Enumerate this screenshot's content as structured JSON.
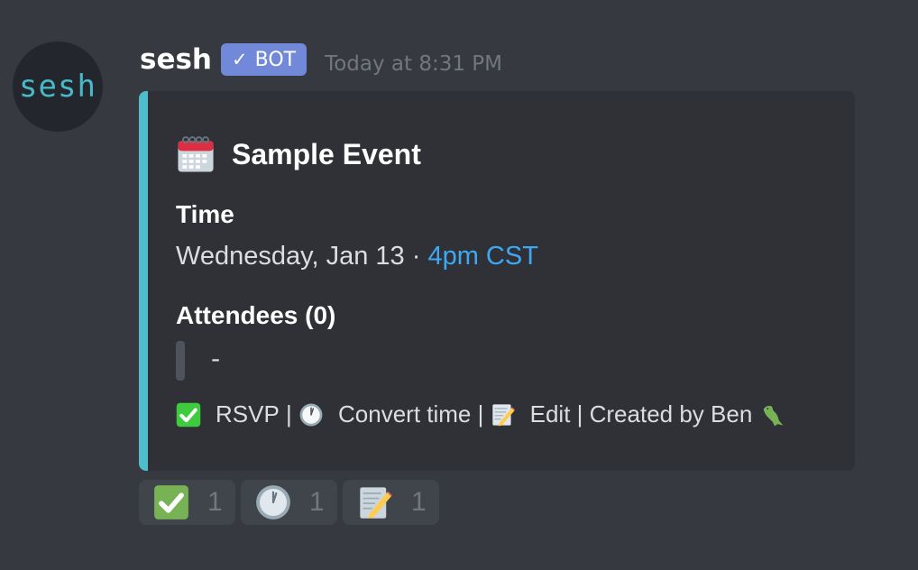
{
  "message": {
    "avatar_text": "sesh",
    "username": "sesh",
    "bot_badge": {
      "check": "✓",
      "label": "BOT"
    },
    "timestamp": "Today at 8:31 PM"
  },
  "embed": {
    "accent_color": "#4fbdca",
    "title_icon": "calendar-icon",
    "title": "Sample Event",
    "fields": [
      {
        "name": "Time",
        "value_date": "Wednesday, Jan 13",
        "separator": " · ",
        "value_link": "4pm CST"
      },
      {
        "name": "Attendees (0)",
        "value": "-"
      }
    ],
    "footer": {
      "rsvp": "RSVP",
      "sep1": " | ",
      "convert": "Convert time",
      "sep2": " | ",
      "edit": "Edit",
      "sep3": " | ",
      "created": "Created by Ben"
    }
  },
  "reactions": [
    {
      "emoji": "white-check-mark",
      "count": "1"
    },
    {
      "emoji": "clock",
      "count": "1"
    },
    {
      "emoji": "memo",
      "count": "1"
    }
  ]
}
